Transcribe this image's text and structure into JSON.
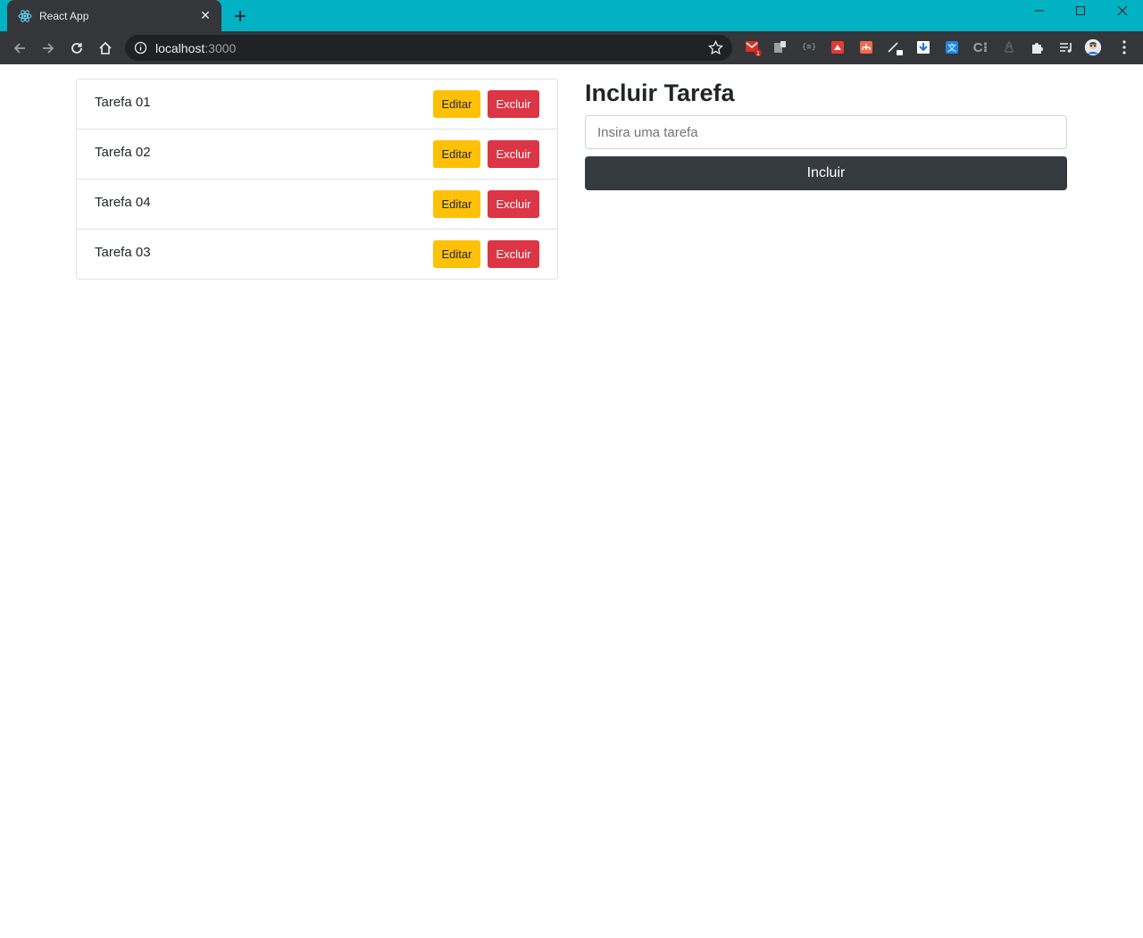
{
  "browser": {
    "tab_title": "React App",
    "url_host": "localhost",
    "url_port": ":3000",
    "extension_badge": "1",
    "theme_color": "#00b2c4"
  },
  "tasks": [
    {
      "name": "Tarefa 01",
      "edit_label": "Editar",
      "delete_label": "Excluir"
    },
    {
      "name": "Tarefa 02",
      "edit_label": "Editar",
      "delete_label": "Excluir"
    },
    {
      "name": "Tarefa 04",
      "edit_label": "Editar",
      "delete_label": "Excluir"
    },
    {
      "name": "Tarefa 03",
      "edit_label": "Editar",
      "delete_label": "Excluir"
    }
  ],
  "form": {
    "title": "Incluir Tarefa",
    "input_placeholder": "Insira uma tarefa",
    "input_value": "",
    "submit_label": "Incluir"
  },
  "colors": {
    "edit_button": "#ffc107",
    "delete_button": "#dc3545",
    "submit_button": "#343a40"
  }
}
